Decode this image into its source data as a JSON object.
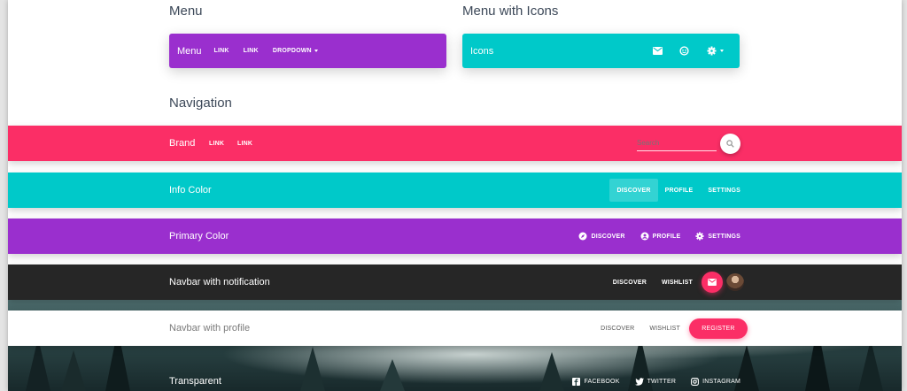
{
  "sections": {
    "menu": "Menu",
    "menu_icons": "Menu with Icons",
    "navigation": "Navigation"
  },
  "menu_bar": {
    "brand": "Menu",
    "links": [
      "LINK",
      "LINK"
    ],
    "dropdown": "DROPDOWN",
    "color": "#9a2fce"
  },
  "menu_icons_bar": {
    "brand": "Icons",
    "icons": [
      "mail-icon",
      "face-icon",
      "gear-icon"
    ],
    "color": "#00c9c9"
  },
  "nav_brand": {
    "brand": "Brand",
    "links": [
      "LINK",
      "LINK"
    ],
    "search_placeholder": "Search",
    "color": "#fb2e66"
  },
  "nav_info": {
    "brand": "Info Color",
    "links": [
      "DISCOVER",
      "PROFILE",
      "SETTINGS"
    ],
    "active": "DISCOVER",
    "color": "#00c9c9"
  },
  "nav_primary": {
    "brand": "Primary Color",
    "links": [
      "DISCOVER",
      "PROFILE",
      "SETTINGS"
    ],
    "icons": [
      "explore-icon",
      "account-icon",
      "gear-icon"
    ],
    "color": "#9a2fce"
  },
  "nav_notification": {
    "brand": "Navbar with notification",
    "links": [
      "DISCOVER",
      "WISHLIST"
    ],
    "color": "#262626",
    "accent": "#fb2e66"
  },
  "nav_profile": {
    "brand": "Navbar with profile",
    "links": [
      "DISCOVER",
      "WISHLIST"
    ],
    "register": "REGISTER",
    "accent": "#fb2e66"
  },
  "nav_transparent": {
    "brand": "Transparent",
    "links": [
      "FACEBOOK",
      "TWITTER",
      "INSTAGRAM"
    ],
    "icons": [
      "facebook-icon",
      "twitter-icon",
      "instagram-icon"
    ]
  }
}
